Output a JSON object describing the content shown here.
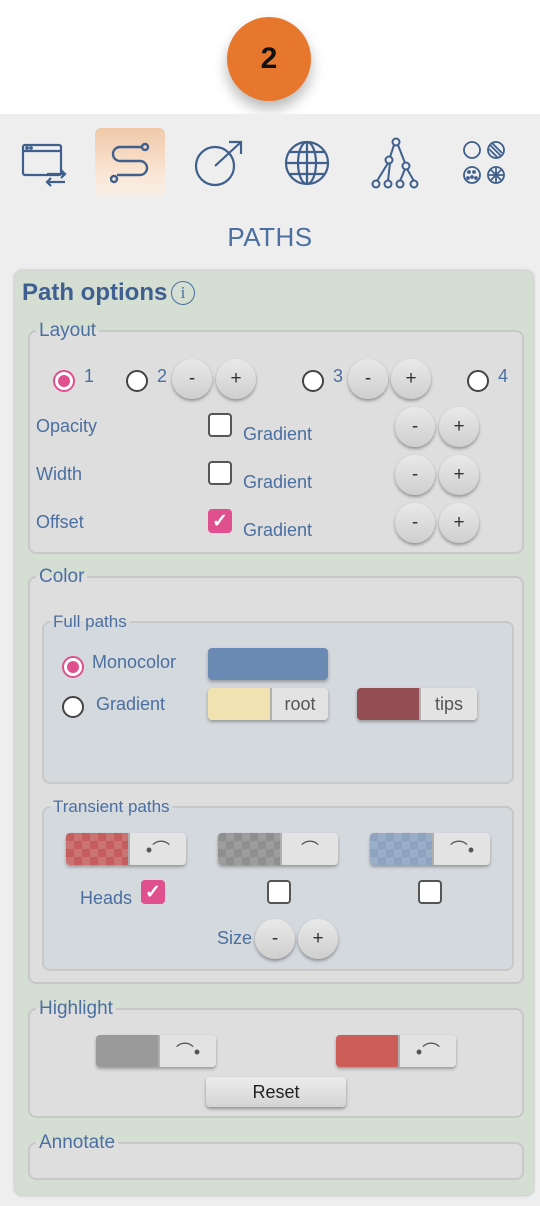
{
  "step_badge": "2",
  "toolbar": {
    "icons": [
      "import-export-icon",
      "paths-icon",
      "vector-icon",
      "globe-icon",
      "tree-icon",
      "patterns-icon"
    ],
    "active": "paths-icon"
  },
  "section_title": "PATHS",
  "path_options": {
    "title": "Path options",
    "info_icon": "i",
    "layout": {
      "legend": "Layout",
      "options": [
        "1",
        "2",
        "3",
        "4"
      ],
      "selected": "1",
      "rows": [
        {
          "label": "Opacity",
          "gradient_label": "Gradient",
          "checked": false
        },
        {
          "label": "Width",
          "gradient_label": "Gradient",
          "checked": false
        },
        {
          "label": "Offset",
          "gradient_label": "Gradient",
          "checked": true
        }
      ],
      "minus": "-",
      "plus": "+"
    },
    "color": {
      "legend": "Color",
      "full_paths": {
        "legend": "Full paths",
        "monocolor_label": "Monocolor",
        "gradient_label": "Gradient",
        "selected": "Monocolor",
        "mono_color": "#6a8ab4",
        "root_color": "#f1e3b1",
        "root_label": "root",
        "tips_color": "#944d52",
        "tips_label": "tips"
      },
      "transient_paths": {
        "legend": "Transient paths",
        "swatch_colors": [
          "#c45e5e",
          "#8f8f8f",
          "#8da3c0"
        ],
        "swatch_glyphs": [
          "•⌒",
          "⌒",
          "⌒•"
        ],
        "heads_label": "Heads",
        "heads_checked": [
          true,
          false,
          false
        ],
        "size_label": "Size"
      }
    },
    "highlight": {
      "legend": "Highlight",
      "swatch_colors": [
        "#9a9a9a",
        "#cc5d58"
      ],
      "swatch_glyphs": [
        "⌒•",
        "•⌒"
      ],
      "reset_label": "Reset"
    },
    "annotate": {
      "legend": "Annotate"
    }
  }
}
